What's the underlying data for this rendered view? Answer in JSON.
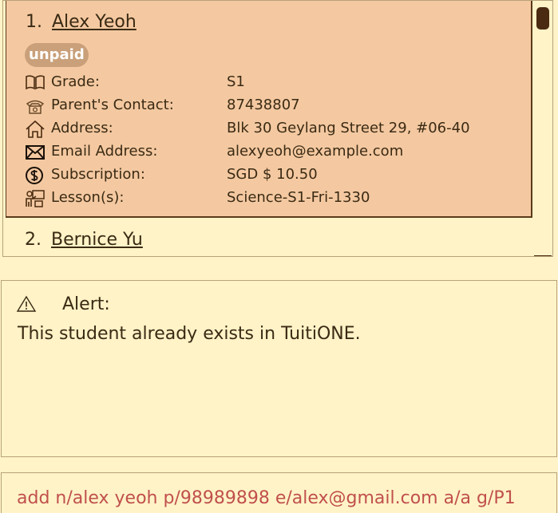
{
  "students": [
    {
      "index": "1.",
      "name": "Alex Yeoh",
      "badge": "unpaid",
      "fields": [
        {
          "icon": "book-icon",
          "label": "Grade:",
          "value": "S1"
        },
        {
          "icon": "phone-icon",
          "label": "Parent's Contact:",
          "value": "87438807"
        },
        {
          "icon": "home-icon",
          "label": "Address:",
          "value": "Blk 30 Geylang Street 29, #06-40"
        },
        {
          "icon": "envelope-icon",
          "label": "Email Address:",
          "value": "alexyeoh@example.com"
        },
        {
          "icon": "dollar-coin-icon",
          "label": "Subscription:",
          "value": "SGD $ 10.50"
        },
        {
          "icon": "teacher-icon",
          "label": "Lesson(s):",
          "value": "Science-S1-Fri-1330"
        }
      ]
    },
    {
      "index": "2.",
      "name": "Bernice Yu"
    }
  ],
  "alert": {
    "icon": "warning-icon",
    "title": "Alert:",
    "message": "This student already exists in TuitiONE."
  },
  "command": {
    "value": "add n/alex yeoh p/98989898 e/alex@gmail.com a/a g/P1"
  },
  "colors": {
    "background": "#FFF3C7",
    "selected_card": "#F4C9A1",
    "badge_unpaid": "#C9A07A",
    "command_text": "#C0504D",
    "dark_accent": "#4A2A10"
  }
}
